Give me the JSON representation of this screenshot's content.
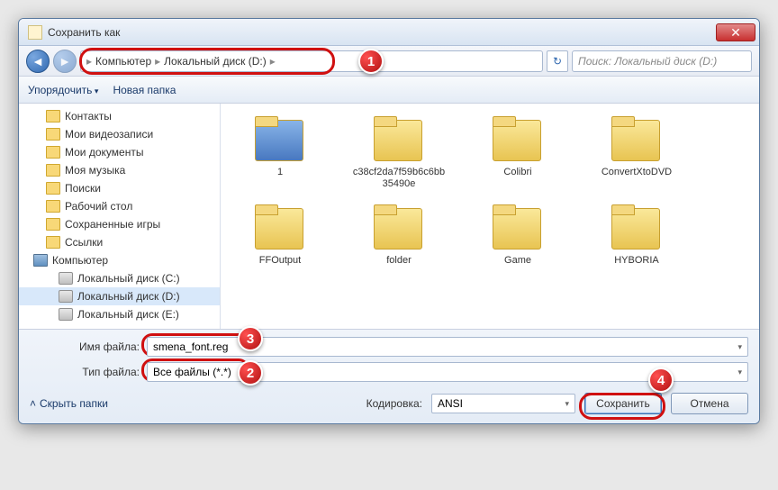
{
  "window": {
    "title": "Сохранить как"
  },
  "breadcrumb": {
    "root": "Компьютер",
    "drive": "Локальный диск (D:)"
  },
  "search": {
    "placeholder": "Поиск: Локальный диск (D:)"
  },
  "toolbar": {
    "organize": "Упорядочить",
    "new_folder": "Новая папка"
  },
  "sidebar": {
    "items": [
      {
        "label": "Контакты",
        "icon": "folder"
      },
      {
        "label": "Мои видеозаписи",
        "icon": "folder"
      },
      {
        "label": "Мои документы",
        "icon": "folder"
      },
      {
        "label": "Моя музыка",
        "icon": "folder"
      },
      {
        "label": "Поиски",
        "icon": "folder"
      },
      {
        "label": "Рабочий стол",
        "icon": "folder"
      },
      {
        "label": "Сохраненные игры",
        "icon": "folder"
      },
      {
        "label": "Ссылки",
        "icon": "folder"
      }
    ],
    "computer": "Компьютер",
    "drives": [
      {
        "label": "Локальный диск (C:)"
      },
      {
        "label": "Локальный диск (D:)"
      },
      {
        "label": "Локальный диск (E:)"
      }
    ]
  },
  "folders": [
    {
      "label": "1",
      "kind": "special"
    },
    {
      "label": "c38cf2da7f59b6c6bb35490e",
      "kind": "folder"
    },
    {
      "label": "Colibri",
      "kind": "folder"
    },
    {
      "label": "ConvertXtoDVD",
      "kind": "folder"
    },
    {
      "label": "FFOutput",
      "kind": "folder"
    },
    {
      "label": "folder",
      "kind": "folder"
    },
    {
      "label": "Game",
      "kind": "folder"
    },
    {
      "label": "HYBORIA",
      "kind": "rar"
    }
  ],
  "fields": {
    "filename_label": "Имя файла:",
    "filename_value": "smena_font.reg",
    "filetype_label": "Тип файла:",
    "filetype_value": "Все файлы  (*.*)"
  },
  "footer": {
    "hide_folders": "Скрыть папки",
    "encoding_label": "Кодировка:",
    "encoding_value": "ANSI",
    "save": "Сохранить",
    "cancel": "Отмена"
  },
  "badges": {
    "1": "1",
    "2": "2",
    "3": "3",
    "4": "4"
  }
}
